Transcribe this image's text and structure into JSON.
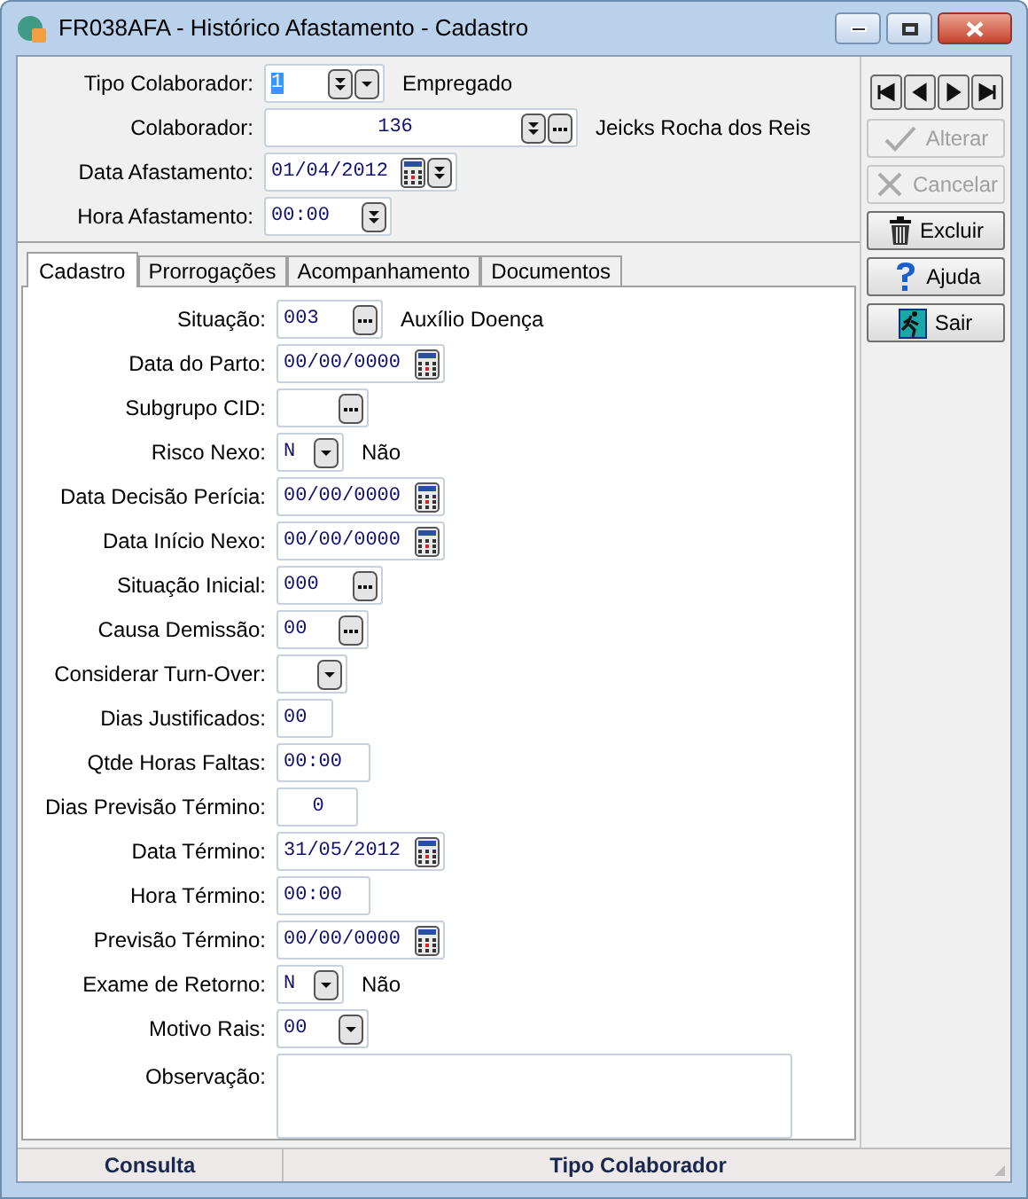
{
  "window": {
    "title": "FR038AFA - Histórico Afastamento - Cadastro"
  },
  "header": {
    "fields": [
      {
        "label": "Tipo Colaborador:",
        "value": "1",
        "text_selected": true,
        "buttons": [
          {
            "kind": "spin"
          },
          {
            "kind": "dropdown"
          }
        ],
        "description": "Empregado"
      },
      {
        "label": "Colaborador:",
        "value": "136",
        "text_selected": false,
        "buttons": [
          {
            "kind": "spin"
          },
          {
            "kind": "ellipsis"
          }
        ],
        "description": "Jeicks Rocha dos Reis"
      },
      {
        "label": "Data Afastamento:",
        "value": "01/04/2012",
        "text_selected": false,
        "buttons": [
          {
            "kind": "calendar"
          },
          {
            "kind": "spin"
          }
        ]
      },
      {
        "label": "Hora Afastamento:",
        "value": "00:00",
        "text_selected": false,
        "buttons": [
          {
            "kind": "spin"
          }
        ]
      }
    ]
  },
  "tabs": [
    {
      "label": "Cadastro",
      "selected": true
    },
    {
      "label": "Prorrogações",
      "selected": false
    },
    {
      "label": "Acompanhamento",
      "selected": false
    },
    {
      "label": "Documentos",
      "selected": false
    }
  ],
  "form": {
    "fields": [
      {
        "label": "Situação:",
        "value": "003",
        "buttons": [
          {
            "kind": "ellipsis"
          }
        ],
        "description": "Auxílio Doença"
      },
      {
        "label": "Data do Parto:",
        "value": "00/00/0000",
        "buttons": [
          {
            "kind": "calendar"
          }
        ]
      },
      {
        "label": "Subgrupo CID:",
        "buttons": [
          {
            "kind": "ellipsis"
          }
        ]
      },
      {
        "label": "Risco Nexo:",
        "value": "N",
        "buttons": [
          {
            "kind": "dropdown"
          }
        ],
        "description": "Não"
      },
      {
        "label": "Data Decisão Perícia:",
        "value": "00/00/0000",
        "buttons": [
          {
            "kind": "calendar"
          }
        ]
      },
      {
        "label": "Data Início Nexo:",
        "value": "00/00/0000",
        "buttons": [
          {
            "kind": "calendar"
          }
        ]
      },
      {
        "label": "Situação Inicial:",
        "value": "000",
        "buttons": [
          {
            "kind": "ellipsis"
          }
        ]
      },
      {
        "label": "Causa Demissão:",
        "value": "00",
        "buttons": [
          {
            "kind": "ellipsis"
          }
        ]
      },
      {
        "label": "Considerar Turn-Over:",
        "buttons": [
          {
            "kind": "dropdown"
          }
        ]
      },
      {
        "label": "Dias Justificados:",
        "value": "00"
      },
      {
        "label": "Qtde Horas Faltas:",
        "value": "00:00"
      },
      {
        "label": "Dias Previsão Término:",
        "value": "0"
      },
      {
        "label": "Data Término:",
        "value": "31/05/2012",
        "buttons": [
          {
            "kind": "calendar"
          }
        ]
      },
      {
        "label": "Hora Término:",
        "value": "00:00"
      },
      {
        "label": "Previsão Término:",
        "value": "00/00/0000",
        "buttons": [
          {
            "kind": "calendar"
          }
        ]
      },
      {
        "label": "Exame de Retorno:",
        "value": "N",
        "buttons": [
          {
            "kind": "dropdown"
          }
        ],
        "description": "Não"
      },
      {
        "label": "Motivo Rais:",
        "value": "00",
        "buttons": [
          {
            "kind": "dropdown"
          }
        ]
      },
      {
        "label": "Observação:",
        "kind": "memo"
      }
    ]
  },
  "side_buttons": [
    {
      "label": "Alterar",
      "kind": "check",
      "disabled": true
    },
    {
      "label": "Cancelar",
      "kind": "cross",
      "disabled": true
    },
    {
      "label": "Excluir",
      "kind": "trash",
      "disabled": false
    },
    {
      "label": "Ajuda",
      "kind": "help",
      "disabled": false
    },
    {
      "label": "Sair",
      "kind": "exit",
      "disabled": false
    }
  ],
  "status_bar": [
    "Consulta",
    "Tipo Colaborador"
  ]
}
